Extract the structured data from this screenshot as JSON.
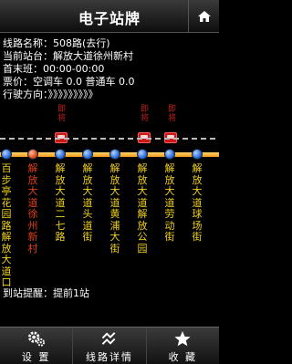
{
  "header": {
    "title": "电子站牌",
    "home_icon": "home-icon"
  },
  "info": {
    "route_name": "线路名称：508路(去行)",
    "current_stop": "当前站台：解放大道徐州新村",
    "first_last": "首末班：00:00-00:00",
    "fare": "票价：空调车 0.0   普通车 0.0",
    "direction": "行驶方向：》》》》》》》》》"
  },
  "buses": [
    {
      "label": "即将"
    },
    {
      "label": "即将"
    },
    {
      "label": "即将"
    }
  ],
  "stops": [
    {
      "name": "百步亭花园路解放大道口",
      "current": false
    },
    {
      "name": "解放大道徐州新村",
      "current": true
    },
    {
      "name": "解放大道二七路",
      "current": false
    },
    {
      "name": "解放大道头道街",
      "current": false
    },
    {
      "name": "解放大道黄浦大街",
      "current": false
    },
    {
      "name": "解放大道解放公园",
      "current": false
    },
    {
      "name": "解放大道劳动街",
      "current": false
    },
    {
      "name": "解放大道球场街",
      "current": false
    }
  ],
  "reminder": "到站提醒：提前1站",
  "tabs": [
    {
      "label": "设 置",
      "icon": "gear-icon"
    },
    {
      "label": "线路详情",
      "icon": "route-icon"
    },
    {
      "label": "收 藏",
      "icon": "star-icon"
    }
  ]
}
